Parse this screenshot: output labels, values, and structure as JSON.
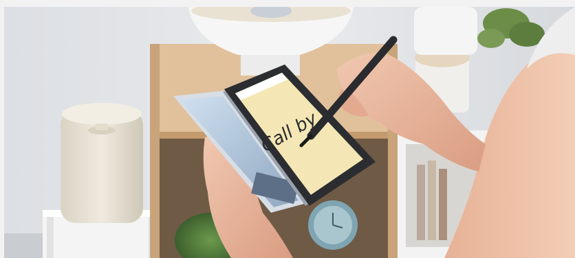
{
  "photo": {
    "handwritten_note": "Call by"
  },
  "colors": {
    "wall": "#e3e6ea",
    "shelf_wood": "#d9b48a",
    "shelf_dark": "#b88c5e",
    "canister": "#e8e3d6",
    "skin": "#e9b9a0",
    "device_body": "#bfc8d3",
    "screen_note": "#f4e7b5",
    "pen": "#2a2b2e",
    "plant": "#4e7a3a",
    "clock": "#8fb3bf"
  }
}
